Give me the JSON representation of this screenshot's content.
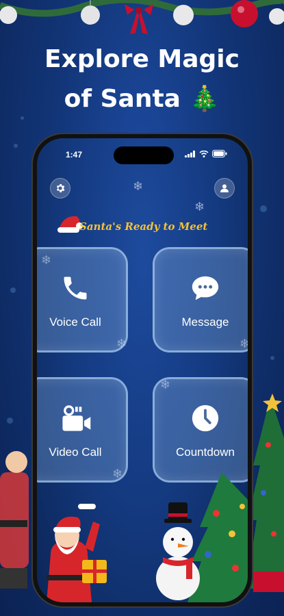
{
  "headline": {
    "line1": "Explore Magic",
    "line2": "of Santa 🎄"
  },
  "status_bar": {
    "time": "1:47"
  },
  "header": {
    "subtitle": "Santa's Ready to Meet"
  },
  "tiles": [
    {
      "label": "Voice Call",
      "icon": "phone-icon"
    },
    {
      "label": "Message",
      "icon": "chat-bubble-icon"
    },
    {
      "label": "Video Call",
      "icon": "video-camera-icon"
    },
    {
      "label": "Countdown",
      "icon": "clock-icon"
    }
  ],
  "colors": {
    "accent_gold": "#f4c23a",
    "background": "#143a80"
  }
}
